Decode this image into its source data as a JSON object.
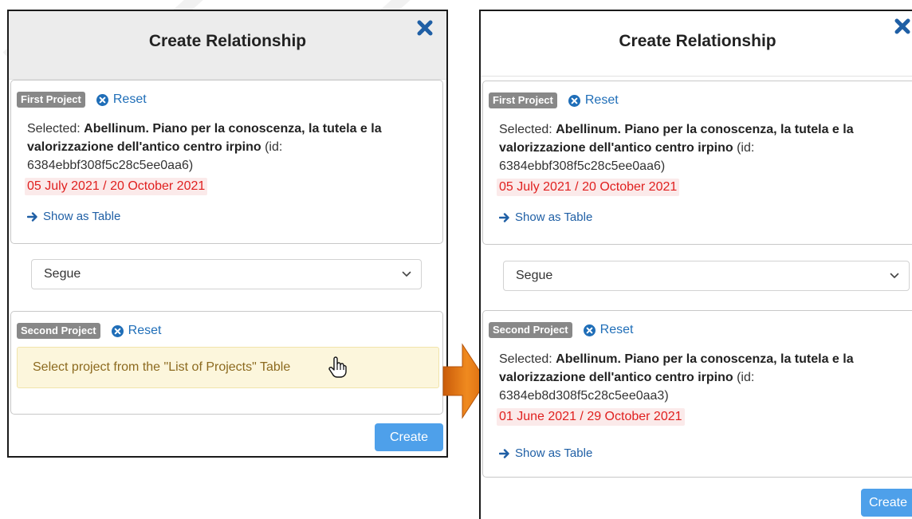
{
  "colors": {
    "badge_bg": "#888888",
    "link": "#1f6eb8",
    "date_text": "#e0201f",
    "date_bg": "#fbeaea",
    "alert_bg": "#fcf6dc",
    "alert_text": "#8c6a1f",
    "primary_button": "#4ea0ea",
    "close_icon": "#1f5fa5",
    "arrow_orange": "#e87a16"
  },
  "left_modal": {
    "title": "Create Relationship",
    "close_icon": "close-icon",
    "first_project": {
      "badge": "First Project",
      "reset_label": "Reset",
      "selected_prefix": "Selected:",
      "project_name": "Abellinum. Piano per la conoscenza, la tutela e la valorizzazione dell'antico centro irpino",
      "id_text": "(id: 6384ebbf308f5c28c5ee0aa6)",
      "date_range": "05 July 2021 / 20 October 2021",
      "show_table_label": "Show as Table"
    },
    "relationship_select": {
      "value": "Segue"
    },
    "second_project": {
      "badge": "Second Project",
      "reset_label": "Reset",
      "alert_text": "Select project from the \"List of Projects\" Table"
    },
    "create_label": "Create"
  },
  "right_modal": {
    "title": "Create Relationship",
    "close_icon": "close-icon",
    "first_project": {
      "badge": "First Project",
      "reset_label": "Reset",
      "selected_prefix": "Selected:",
      "project_name": "Abellinum. Piano per la conoscenza, la tutela e la valorizzazione dell'antico centro irpino",
      "id_text": "(id: 6384ebbf308f5c28c5ee0aa6)",
      "date_range": "05 July 2021 / 20 October 2021",
      "show_table_label": "Show as Table"
    },
    "relationship_select": {
      "value": "Segue"
    },
    "second_project": {
      "badge": "Second Project",
      "reset_label": "Reset",
      "selected_prefix": "Selected:",
      "project_name": "Abellinum. Piano per la conoscenza, la tutela e la valorizzazione dell'antico centro irpino",
      "id_text": "(id: 6384eb8d308f5c28c5ee0aa3)",
      "date_range": "01 June 2021 / 29 October 2021",
      "show_table_label": "Show as Table"
    },
    "create_label": "Create"
  }
}
